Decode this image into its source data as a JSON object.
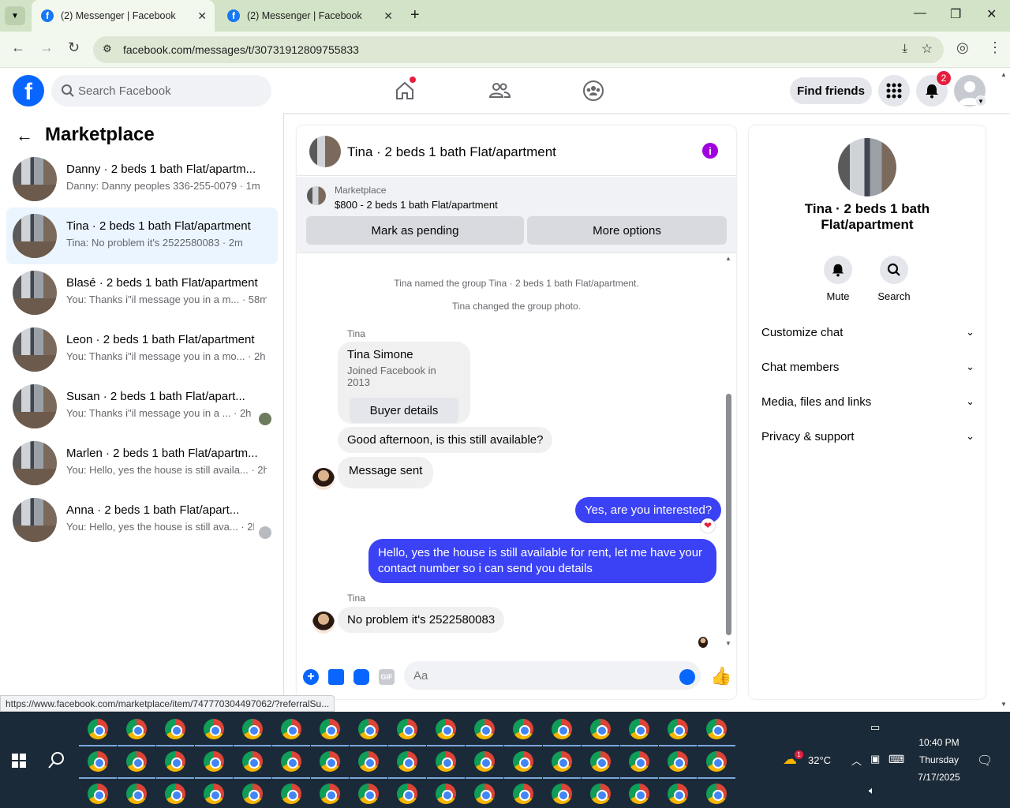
{
  "browser": {
    "tabs": [
      {
        "title": "(2) Messenger | Facebook",
        "active": true
      },
      {
        "title": "(2) Messenger | Facebook",
        "active": false
      }
    ],
    "url": "facebook.com/messages/t/30731912809755833",
    "status_url": "https://www.facebook.com/marketplace/item/747770304497062/?referralSu..."
  },
  "fb_header": {
    "logo": "f",
    "search_placeholder": "Search Facebook",
    "find_friends": "Find friends",
    "notif_count": "2"
  },
  "sidebar": {
    "title": "Marketplace",
    "conversations": [
      {
        "title": "Danny · 2 beds 1 bath Flat/apartm...",
        "snippet": "Danny: Danny peoples 336-255-0079 · 1m",
        "active": false
      },
      {
        "title": "Tina · 2 beds 1 bath Flat/apartment",
        "snippet": "Tina: No problem it's 2522580083 · 2m",
        "active": true
      },
      {
        "title": "Blasé · 2 beds 1 bath Flat/apartment",
        "snippet": "You: Thanks i\"il message you in a m... · 58m",
        "active": false
      },
      {
        "title": "Leon · 2 beds 1 bath Flat/apartment",
        "snippet": "You: Thanks i\"il message you in a mo... · 2h",
        "active": false
      },
      {
        "title": "Susan · 2 beds 1 bath Flat/apart...",
        "snippet": "You: Thanks i\"il message you in a ... · 2h",
        "active": false
      },
      {
        "title": "Marlen · 2 beds 1 bath Flat/apartm...",
        "snippet": "You: Hello, yes the house is still availa... · 2h",
        "active": false
      },
      {
        "title": "Anna · 2 beds 1 bath Flat/apart...",
        "snippet": "You: Hello, yes the house is still ava... · 2h",
        "active": false
      }
    ]
  },
  "chat": {
    "title": "Tina · 2 beds 1 bath Flat/apartment",
    "marketplace_label": "Marketplace",
    "listing": "$800 - 2 beds 1 bath Flat/apartment",
    "mark_pending": "Mark as pending",
    "more_options": "More options",
    "system_1": "Tina named the group Tina · 2 beds 1 bath Flat/apartment.",
    "system_2": "Tina changed the group photo.",
    "sender_name": "Tina",
    "card_name": "Tina Simone",
    "card_joined": "Joined Facebook in 2013",
    "buyer_details": "Buyer details",
    "msg_1": "Good afternoon, is this still available?",
    "msg_2": "Message sent",
    "msg_3": "Yes, are you interested?",
    "msg_4": "Hello, yes the house is still available for rent, let me have your contact number so i can send you details",
    "msg_5": "No problem it's 2522580083",
    "input_placeholder": "Aa",
    "gif": "GIF"
  },
  "details": {
    "name": "Tina · 2 beds 1 bath Flat/apartment",
    "mute": "Mute",
    "search": "Search",
    "rows": [
      "Customize chat",
      "Chat members",
      "Media, files and links",
      "Privacy & support"
    ]
  },
  "taskbar": {
    "temperature": "32°C",
    "weather_badge": "1",
    "time": "10:40 PM",
    "day": "Thursday",
    "date": "7/17/2025"
  },
  "colors": {
    "fb_blue": "#0866ff",
    "outgoing_bubble": "#3b42f5",
    "badge_red": "#e41e3f",
    "info_purple": "#a000e0",
    "tab_strip": "#d3e3c7",
    "taskbar": "#1b2a38"
  }
}
